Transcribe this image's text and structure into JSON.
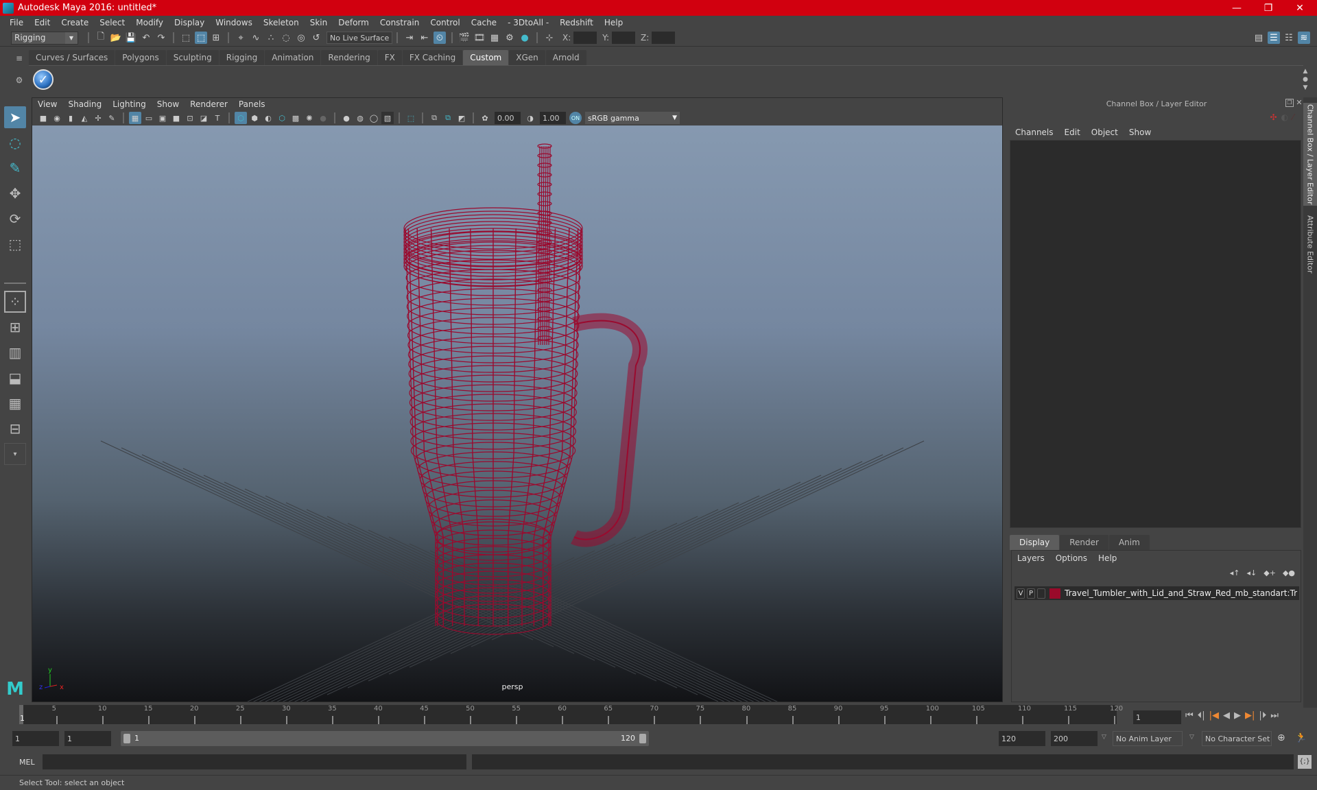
{
  "window": {
    "title": "Autodesk Maya 2016: untitled*",
    "controls": {
      "minimize": "—",
      "maximize": "❐",
      "close": "✕"
    }
  },
  "menubar": [
    "File",
    "Edit",
    "Create",
    "Select",
    "Modify",
    "Display",
    "Windows",
    "Skeleton",
    "Skin",
    "Deform",
    "Constrain",
    "Control",
    "Cache",
    "- 3DtoAll -",
    "Redshift",
    "Help"
  ],
  "statusline": {
    "mode": "Rigging",
    "live_surface": "No Live Surface",
    "x_label": "X:",
    "y_label": "Y:",
    "z_label": "Z:",
    "x_value": "",
    "y_value": "",
    "z_value": ""
  },
  "shelf": {
    "tabs": [
      "Curves / Surfaces",
      "Polygons",
      "Sculpting",
      "Rigging",
      "Animation",
      "Rendering",
      "FX",
      "FX Caching",
      "Custom",
      "XGen",
      "Arnold"
    ],
    "active_tab": "Custom"
  },
  "viewport": {
    "menu": [
      "View",
      "Shading",
      "Lighting",
      "Show",
      "Renderer",
      "Panels"
    ],
    "exposure": "0.00",
    "gamma": "1.00",
    "color_space": "sRGB gamma",
    "camera_label": "persp",
    "axis": {
      "x": "x",
      "y": "y",
      "z": "z"
    },
    "wire_color": "#9a0a2e"
  },
  "channel_box": {
    "title": "Channel Box / Layer Editor",
    "menu": [
      "Channels",
      "Edit",
      "Object",
      "Show"
    ]
  },
  "layer_editor": {
    "tabs": [
      "Display",
      "Render",
      "Anim"
    ],
    "active_tab": "Display",
    "menu": [
      "Layers",
      "Options",
      "Help"
    ],
    "layers": [
      {
        "v": "V",
        "p": "P",
        "color": "#9a0a2a",
        "name": "Travel_Tumbler_with_Lid_and_Straw_Red_mb_standart:Tr"
      }
    ]
  },
  "side_tabs": [
    "Channel Box / Layer Editor",
    "Attribute Editor"
  ],
  "timeline": {
    "ticks": [
      "5",
      "10",
      "15",
      "20",
      "25",
      "30",
      "35",
      "40",
      "45",
      "50",
      "55",
      "60",
      "65",
      "70",
      "75",
      "80",
      "85",
      "90",
      "95",
      "100",
      "105",
      "110",
      "115",
      "120"
    ],
    "current_frame_marker": "1",
    "current_frame": "1"
  },
  "range": {
    "start": "1",
    "anim_start": "1",
    "slider_start": "1",
    "slider_end": "120",
    "anim_end": "120",
    "end": "200",
    "anim_layer": "No Anim Layer",
    "character_set": "No Character Set"
  },
  "command_line": {
    "label": "MEL",
    "input": "",
    "output": ""
  },
  "help_line": "Select Tool: select an object"
}
